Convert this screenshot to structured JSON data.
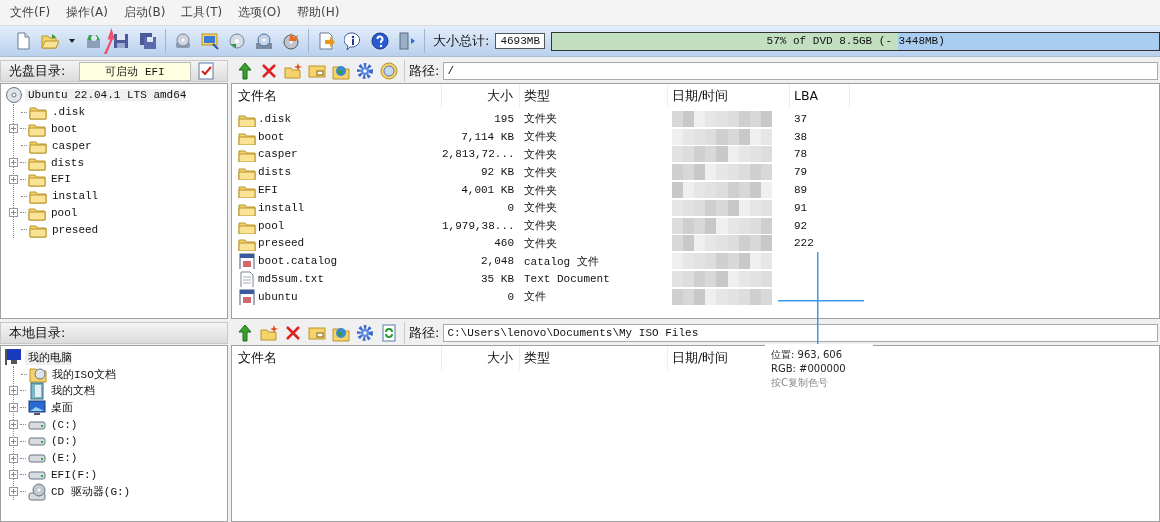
{
  "menu": [
    "文件(F)",
    "操作(A)",
    "启动(B)",
    "工具(T)",
    "选项(O)",
    "帮助(H)"
  ],
  "size_total": {
    "label": "大小总计:",
    "value": "4693MB",
    "meter": {
      "level": 0.57,
      "text": "57% of DVD 8.5GB (- 3448MB)"
    }
  },
  "disc_pane": {
    "label": "光盘目录:",
    "boot_field": "可启动 EFI",
    "path_label": "路径:",
    "path": "/",
    "tree": {
      "label": "Ubuntu 22.04.1 LTS amd64",
      "children": [
        {
          "label": ".disk",
          "expandable": false
        },
        {
          "label": "boot",
          "expandable": true
        },
        {
          "label": "casper",
          "expandable": false
        },
        {
          "label": "dists",
          "expandable": true
        },
        {
          "label": "EFI",
          "expandable": true
        },
        {
          "label": "install",
          "expandable": false
        },
        {
          "label": "pool",
          "expandable": true
        },
        {
          "label": "preseed",
          "expandable": false
        }
      ]
    },
    "columns": [
      "文件名",
      "大小",
      "类型",
      "日期/时间",
      "LBA"
    ],
    "rows": [
      {
        "kind": "folder",
        "name": ".disk",
        "size": "195",
        "type": "文件夹",
        "lba": "37"
      },
      {
        "kind": "folder",
        "name": "boot",
        "size": "7,114 KB",
        "type": "文件夹",
        "lba": "38"
      },
      {
        "kind": "folder",
        "name": "casper",
        "size": "2,813,72...",
        "type": "文件夹",
        "lba": "78"
      },
      {
        "kind": "folder",
        "name": "dists",
        "size": "92 KB",
        "type": "文件夹",
        "lba": "79"
      },
      {
        "kind": "folder",
        "name": "EFI",
        "size": "4,001 KB",
        "type": "文件夹",
        "lba": "89"
      },
      {
        "kind": "folder",
        "name": "install",
        "size": "0",
        "type": "文件夹",
        "lba": "91"
      },
      {
        "kind": "folder",
        "name": "pool",
        "size": "1,979,38...",
        "type": "文件夹",
        "lba": "92"
      },
      {
        "kind": "folder",
        "name": "preseed",
        "size": "460",
        "type": "文件夹",
        "lba": "222"
      },
      {
        "kind": "system",
        "name": "boot.catalog",
        "size": "2,048",
        "type": "catalog 文件"
      },
      {
        "kind": "text",
        "name": "md5sum.txt",
        "size": "35 KB",
        "type": "Text Document"
      },
      {
        "kind": "system",
        "name": "ubuntu",
        "size": "0",
        "type": "文件"
      }
    ]
  },
  "local_pane": {
    "label": "本地目录:",
    "path_label": "路径:",
    "path": "C:\\Users\\lenovo\\Documents\\My ISO Files",
    "tree": {
      "label": "我的电脑",
      "children": [
        {
          "label": "我的ISO文档",
          "kind": "isodocs",
          "expandable": false
        },
        {
          "label": "我的文档",
          "kind": "docs",
          "expandable": true
        },
        {
          "label": "桌面",
          "kind": "desktop",
          "expandable": true
        },
        {
          "label": "(C:)",
          "kind": "drive",
          "expandable": true
        },
        {
          "label": "(D:)",
          "kind": "drive",
          "expandable": true
        },
        {
          "label": "(E:)",
          "kind": "drive",
          "expandable": true
        },
        {
          "label": "EFI(F:)",
          "kind": "drive",
          "expandable": true
        },
        {
          "label": "CD 驱动器(G:)",
          "kind": "cd",
          "expandable": true
        }
      ]
    },
    "columns": [
      "文件名",
      "大小",
      "类型",
      "日期/时间"
    ]
  },
  "color_picker": {
    "position": "位置: 963, 606",
    "rgb": "RGB: #000000",
    "hint": "按C复制色号"
  },
  "annotations": [
    {
      "kind": "arrow"
    }
  ]
}
